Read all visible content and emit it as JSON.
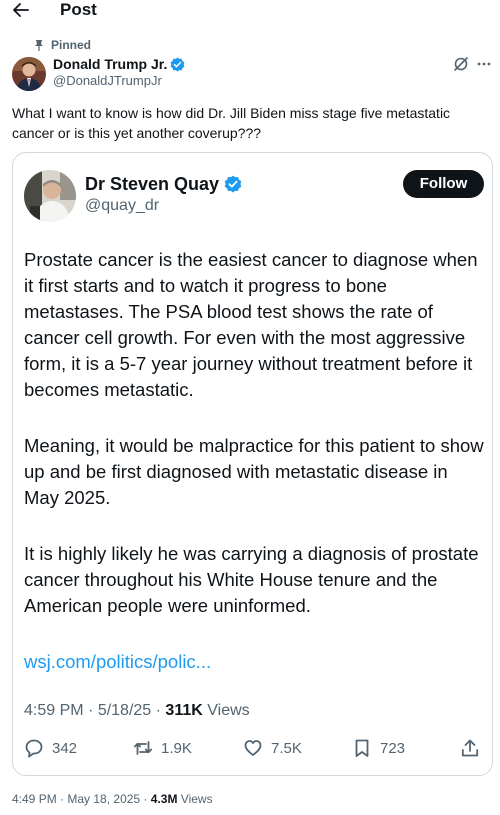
{
  "header": {
    "title": "Post",
    "back_icon": "arrow-left-icon"
  },
  "pinned_label": "Pinned",
  "author": {
    "name": "Donald Trump Jr.",
    "handle": "@DonaldJTrumpJr",
    "verified": true
  },
  "tweet_text": "What I want to know is how did Dr. Jill Biden miss stage five metastatic cancer or is this yet another coverup???",
  "quote": {
    "name": "Dr Steven Quay",
    "handle": "@quay_dr",
    "follow_label": "Follow",
    "paragraphs": [
      "Prostate cancer is the easiest cancer to diagnose when it first starts and to watch it progress to bone metastases. The PSA blood test shows the rate of cancer cell growth. For even with the most aggressive form, it is a 5-7 year journey without treatment before it becomes metastatic.",
      "Meaning, it would be malpractice for this patient to show up and be first diagnosed with metastatic disease in May 2025.",
      "It is highly likely he was carrying a diagnosis of prostate cancer throughout his White House tenure and the American people were uninformed."
    ],
    "link": "wsj.com/politics/polic...",
    "time": "4:59 PM",
    "date": "5/18/25",
    "views_count": "311K",
    "views_label": "Views",
    "stats": {
      "replies": "342",
      "reposts": "1.9K",
      "likes": "7.5K",
      "bookmarks": "723"
    }
  },
  "post_meta": {
    "time": "4:49 PM",
    "date": "May 18, 2025",
    "views_count": "4.3M",
    "views_label": "Views"
  },
  "colors": {
    "accent": "#1d9bf0",
    "secondary_text": "#536471",
    "border": "#cfd9de"
  }
}
